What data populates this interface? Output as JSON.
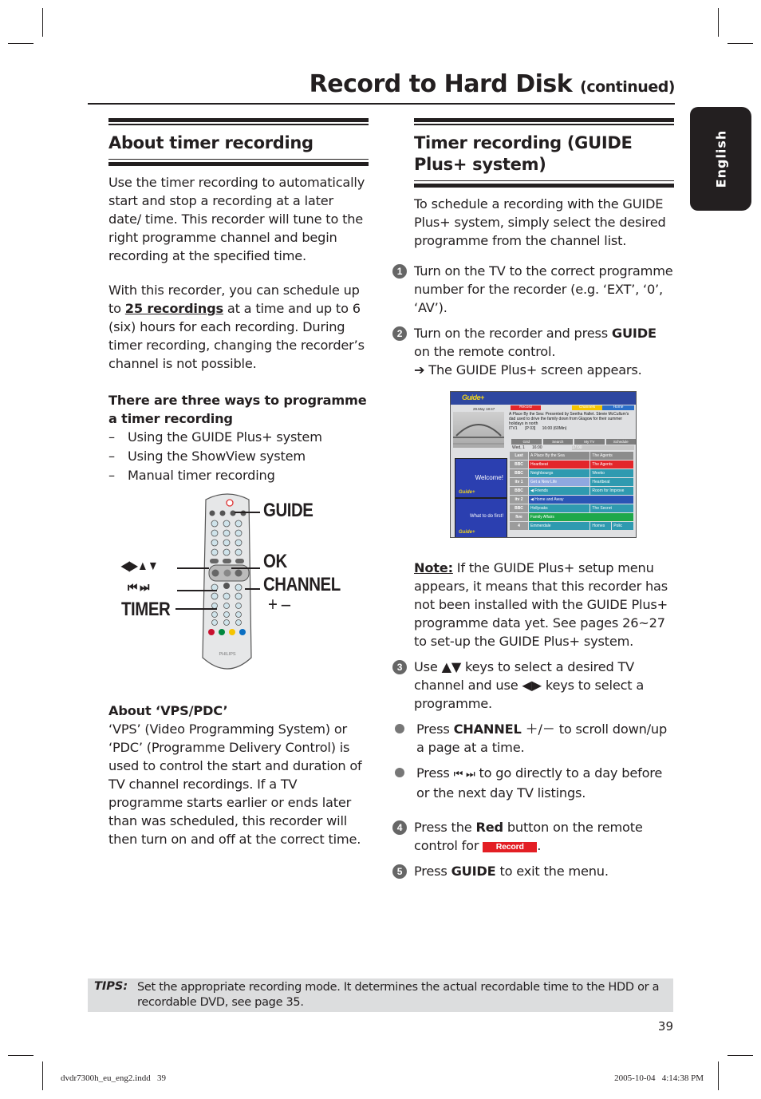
{
  "page": {
    "title": "Record to Hard Disk",
    "title_suffix": "(continued)",
    "language_tab": "English",
    "page_number": "39",
    "slug_left": "dvdr7300h_eu_eng2.indd   39",
    "slug_right": "2005-10-04   4:14:38 PM"
  },
  "left": {
    "heading": "About timer recording",
    "para1": "Use the timer recording to automatically start and stop a recording at a later date/ time. This recorder will tune to the right programme channel and begin recording at the specified time.",
    "para2_pre": "With this recorder, you can schedule up to ",
    "para2_bold": "25 recordings",
    "para2_post": " at a time and up to 6 (six) hours for each recording.  During timer recording, changing the recorder’s channel is not possible.",
    "ways_heading": "There are three ways to programme a timer recording",
    "ways": [
      "Using the GUIDE Plus+ system",
      "Using the ShowView system",
      "Manual timer recording"
    ],
    "vps_heading": "About ‘VPS/PDC’",
    "vps_text": "‘VPS’ (Video Programming System) or ‘PDC’ (Programme Delivery Control) is used to control the start and duration of TV channel recordings. If a TV programme starts earlier or ends later than was scheduled, this recorder will then turn on and off at the correct time."
  },
  "remote": {
    "labels": {
      "guide": "GUIDE",
      "arrows": "◀▶▲▼",
      "ok": "OK",
      "channel": "CHANNEL",
      "channel_plusminus": "+ –",
      "skip": "⏮  ⏭",
      "timer": "TIMER"
    },
    "brand": "PHILIPS"
  },
  "right": {
    "heading": "Timer recording (GUIDE Plus+ system)",
    "intro": "To schedule a recording with the GUIDE Plus+ system, simply select the desired programme from the channel list.",
    "step1": "Turn on the TV to the correct programme number for the recorder (e.g. ‘EXT’, ‘0’, ‘AV’).",
    "step2_pre": "Turn on the recorder and press ",
    "step2_bold": "GUIDE",
    "step2_post": " on the remote control.",
    "step2_result": "➔ The GUIDE Plus+ screen appears.",
    "note_label": "Note:",
    "note_text": " If the GUIDE Plus+ setup menu appears, it means that this recorder has not been installed with the GUIDE Plus+ programme data yet. See pages 26~27 to set-up the GUIDE Plus+ system.",
    "step3": "Use ▲▼ keys to select a desired TV channel and use ◀▶ keys to select a programme.",
    "bullet1_pre": "Press ",
    "bullet1_bold": "CHANNEL",
    "bullet1_sym": " ＋/－ ",
    "bullet1_post": " to scroll down/up a page at a time.",
    "bullet2_pre": "Press ",
    "bullet2_sym": "⏮  ⏭",
    "bullet2_post": " to go directly to a day before or the next day TV listings.",
    "step4_pre": "Press the ",
    "step4_bold": "Red",
    "step4_mid": " button on the remote control for ",
    "step4_badge": "Record",
    "step4_post": ".",
    "step5_pre": "Press ",
    "step5_bold": "GUIDE",
    "step5_post": " to exit the menu.",
    "step_numbers": [
      "1",
      "2",
      "3",
      "4",
      "5"
    ]
  },
  "guide_screen": {
    "logo": "Guide+",
    "date": "29.May   18:47",
    "buttons": {
      "record": "Record",
      "channels": "Channels",
      "home": "Home"
    },
    "description": "A Place By the Sea: Presented by Seetha Hallet. Stevie McCullum's dad used to drive the family down from Glagow for their summer holidays in north",
    "info_line": "ITV1       [P 03]      16:00 (60Min)",
    "tabs": [
      "Grid",
      "Search",
      "My TV",
      "Schedule"
    ],
    "day": "Wed, 1",
    "time1": "16:00",
    "time2": "17:00",
    "panel1": "Welcome!",
    "panel2": "What to do first!",
    "rows": [
      {
        "channel": "Last Channel",
        "progs": [
          "A Place By the Sea",
          "The Agents"
        ],
        "colors": [
          "#8c8c8c",
          "#8c8c8c"
        ]
      },
      {
        "channel": "BBC ONE",
        "progs": [
          "Heartbeat",
          "The Agents"
        ],
        "colors": [
          "#e3262b",
          "#e3262b"
        ]
      },
      {
        "channel": "BBC TWO",
        "progs": [
          "Neighbourgs",
          "Weeko"
        ],
        "colors": [
          "#2f9ab0",
          "#2f9ab0"
        ]
      },
      {
        "channel": "itv 1",
        "progs": [
          "Get a New Life",
          "Heartbeat"
        ],
        "colors": [
          "#8fa8e0",
          "#2f9ab0"
        ]
      },
      {
        "channel": "BBC TWO",
        "progs": [
          "◀ Friends",
          "Room for Improve"
        ],
        "colors": [
          "#2f9ab0",
          "#2f9ab0"
        ]
      },
      {
        "channel": "itv 2",
        "progs": [
          "◀ Home and Away"
        ],
        "colors": [
          "#2a55b5"
        ]
      },
      {
        "channel": "BBC ONE",
        "progs": [
          "Hollyoaks",
          "The Secret"
        ],
        "colors": [
          "#2f9ab0",
          "#2f9ab0"
        ]
      },
      {
        "channel": "five",
        "progs": [
          "Family Affairs"
        ],
        "colors": [
          "#1ea84a"
        ]
      },
      {
        "channel": "4",
        "progs": [
          "Emmerdale",
          "Homes",
          "Polic"
        ],
        "colors": [
          "#2f9ab0",
          "#2f9ab0",
          "#2f9ab0"
        ]
      }
    ]
  },
  "tips": {
    "label": "TIPS:",
    "text": "Set the appropriate recording mode. It determines the actual recordable time to the HDD or a recordable DVD, see page 35."
  },
  "colors": {
    "text": "#231f20",
    "tips_bg": "#dcddde",
    "record_red": "#e31e24",
    "guide_blue": "#2e47a0"
  }
}
